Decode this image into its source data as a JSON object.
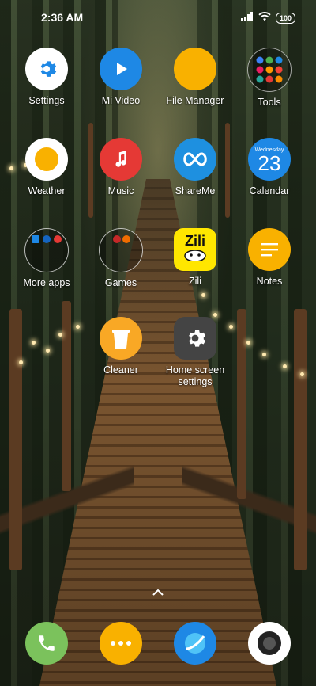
{
  "status": {
    "time": "2:36 AM",
    "battery": "100"
  },
  "apps": [
    {
      "id": "settings",
      "label": "Settings",
      "icon": "gear-icon"
    },
    {
      "id": "mi-video",
      "label": "Mi Video",
      "icon": "play-icon"
    },
    {
      "id": "file-manager",
      "label": "File Manager",
      "icon": "folder-icon"
    },
    {
      "id": "tools",
      "label": "Tools",
      "icon": "folder-grid-icon"
    },
    {
      "id": "weather",
      "label": "Weather",
      "icon": "sun-icon"
    },
    {
      "id": "music",
      "label": "Music",
      "icon": "music-note-icon"
    },
    {
      "id": "shareme",
      "label": "ShareMe",
      "icon": "infinity-icon"
    },
    {
      "id": "calendar",
      "label": "Calendar",
      "icon": "calendar-icon",
      "day": "Wednesday",
      "date": "23"
    },
    {
      "id": "more-apps",
      "label": "More apps",
      "icon": "folder-grid-icon"
    },
    {
      "id": "games",
      "label": "Games",
      "icon": "folder-grid-icon"
    },
    {
      "id": "zili",
      "label": "Zili",
      "icon": "zili-logo",
      "logo_text": "Zili"
    },
    {
      "id": "notes",
      "label": "Notes",
      "icon": "notes-icon"
    },
    {
      "id": "cleaner",
      "label": "Cleaner",
      "icon": "trash-icon"
    },
    {
      "id": "home-screen-settings",
      "label": "Home screen settings",
      "icon": "gear-icon"
    }
  ],
  "dock": [
    {
      "id": "phone",
      "icon": "phone-icon"
    },
    {
      "id": "messages",
      "icon": "chat-dots-icon"
    },
    {
      "id": "browser",
      "icon": "browser-icon"
    },
    {
      "id": "camera",
      "icon": "camera-icon"
    }
  ],
  "colors": {
    "settings": "#ffffff",
    "mi_video": "#1e88e5",
    "file_manager": "#f9b100",
    "weather": "#ffffff",
    "music": "#e53935",
    "shareme": "#1e90e0",
    "calendar": "#1e88e5",
    "notes": "#f9b100",
    "cleaner": "#f9a825",
    "home_settings": "#444444",
    "phone": "#7bc25c",
    "messages": "#f9b100",
    "browser": "#1e88e5",
    "camera": "#ffffff"
  }
}
